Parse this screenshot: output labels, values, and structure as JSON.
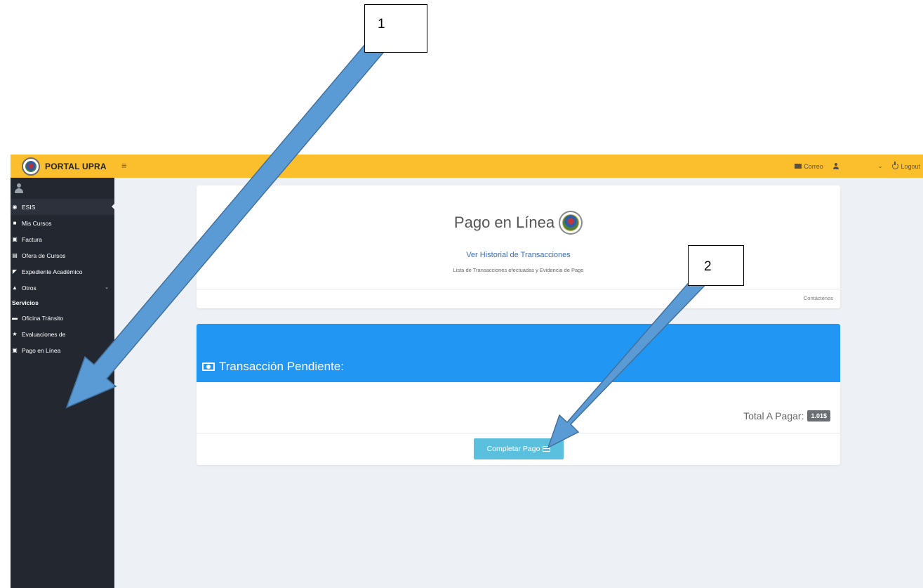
{
  "topbar": {
    "brand": "PORTAL UPRA",
    "menu_icon": "hamburger-icon",
    "correo": "Correo",
    "logout": "Logout",
    "color": "#fbbf2d"
  },
  "sidebar": {
    "items": [
      {
        "label": "ESIS",
        "icon": "dashboard-icon"
      },
      {
        "label": "Mis Cursos",
        "icon": "book-icon"
      },
      {
        "label": "Factura",
        "icon": "money-icon"
      },
      {
        "label": "Ofera de Cursos",
        "icon": "calendar-icon"
      },
      {
        "label": "Expediente Académico",
        "icon": "book-open-icon"
      },
      {
        "label": "Otros",
        "icon": "sitemap-icon"
      }
    ],
    "section_header": "Servicios",
    "service_items": [
      {
        "label": "Oficina Tránsito",
        "icon": "car-icon"
      },
      {
        "label": "Evaluaciones de",
        "icon": "star-icon"
      },
      {
        "label": "Pago en Línea",
        "icon": "money-icon"
      }
    ],
    "color": "#232730"
  },
  "main": {
    "page_title": "Pago en Línea",
    "history_link": "Ver Historial de Transacciones",
    "history_subtitle": "Lista de Transacciones efectuadas y Evidencia de Pago",
    "contact": "Contáctenos",
    "transaction_title": "Transacción Pendiente:",
    "total_label": "Total A Pagar:",
    "total_value": "1.01$",
    "pay_button": "Completar Pago",
    "header_color": "#2196f3",
    "button_color": "#5bc0de"
  },
  "annotations": {
    "label_1": "1",
    "label_2": "2",
    "arrow_color": "#5b9bd5"
  }
}
